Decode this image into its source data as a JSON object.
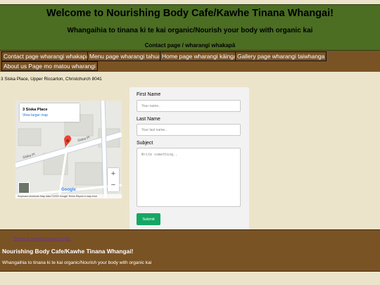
{
  "header": {
    "title": "Welcome to Nourishing Body Cafe/Kawhe Tinana Whangai!",
    "subtitle": "Whangaihia to tinana ki te kai organic/Nourish your body with organic kai",
    "breadcrumb": "Contact page / wharangi whakapā"
  },
  "nav": {
    "items": [
      "Contact page wharangi whakapā",
      "Menu page wharangi tahua",
      "Home page wharangi kāinga",
      "Gallery page wharangi taiwhanga",
      "About us Page mo matou wharangi"
    ]
  },
  "address": "3 Siska Place, Upper Riccarton, Christchurch 8041",
  "map": {
    "place_name": "3 Siska Place",
    "larger_map_link": "View larger map",
    "street_label_1": "Siska Pl",
    "street_label_2": "Siska Pl",
    "zoom_in": "+",
    "zoom_out": "−",
    "logo": "Google",
    "footer_text": "Keyboard shortcuts   Map data ©2025 Google   Terms   Report a map error",
    "pin_color": "#ea4335"
  },
  "form": {
    "first_name_label": "First Name",
    "first_name_placeholder": "Your name..",
    "last_name_label": "Last Name",
    "last_name_placeholder": "Your last name..",
    "subject_label": "Subject",
    "subject_placeholder": "Write something..",
    "submit_label": "Submit",
    "submit_color": "#14a764"
  },
  "footer": {
    "links": [
      "Terms of service",
      "privacy policy"
    ],
    "title": "Nourishing Body Cafe/Kawhe Tinana Whangai!",
    "tagline": "Whangaihia to tinana ki te kai organic/Nourish your body with organic kai"
  },
  "colors": {
    "header_bg": "#4b6e23",
    "nav_bg": "#7a5325",
    "page_bg": "#ece4ca"
  }
}
